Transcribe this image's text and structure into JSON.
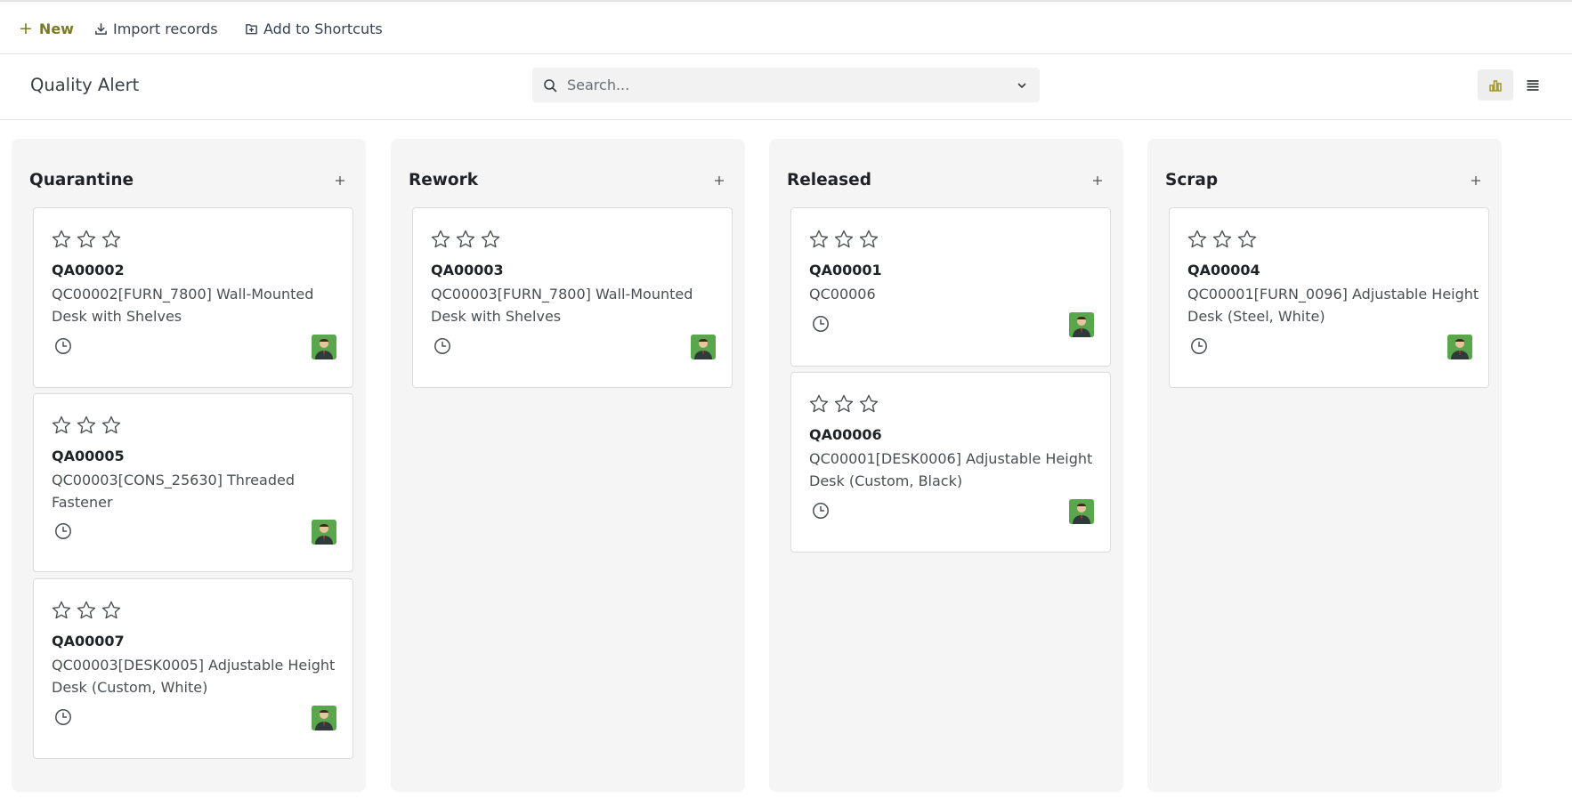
{
  "toolbar": {
    "new_label": "New",
    "import_label": "Import records",
    "shortcut_label": "Add to Shortcuts"
  },
  "page": {
    "title": "Quality Alert"
  },
  "search": {
    "placeholder": "Search..."
  },
  "colors": {
    "accent": "#7c7a1f",
    "column_bg": "#f5f5f5",
    "avatar_bg": "#5aa64d"
  },
  "icons": {
    "new": "plus-icon",
    "import": "download-icon",
    "shortcut": "shortcut-icon",
    "search": "search-icon",
    "dropdown": "chevron-down-icon",
    "kanban_view": "bar-chart-icon",
    "list_view": "list-icon",
    "rating": "star-icon",
    "activity": "clock-icon"
  },
  "columns": [
    {
      "title": "Quarantine",
      "cards": [
        {
          "ref": "QA00002",
          "desc": "QC00002[FURN_7800] Wall-Mounted Desk with Shelves",
          "stars": 0
        },
        {
          "ref": "QA00005",
          "desc": "QC00003[CONS_25630] Threaded Fastener",
          "stars": 0
        },
        {
          "ref": "QA00007",
          "desc": "QC00003[DESK0005] Adjustable Height Desk (Custom, White)",
          "stars": 0
        }
      ]
    },
    {
      "title": "Rework",
      "cards": [
        {
          "ref": "QA00003",
          "desc": "QC00003[FURN_7800] Wall-Mounted Desk with Shelves",
          "stars": 0
        }
      ]
    },
    {
      "title": "Released",
      "cards": [
        {
          "ref": "QA00001",
          "desc": "QC00006",
          "stars": 0
        },
        {
          "ref": "QA00006",
          "desc": "QC00001[DESK0006] Adjustable Height Desk (Custom, Black)",
          "stars": 0
        }
      ]
    },
    {
      "title": "Scrap",
      "cards": [
        {
          "ref": "QA00004",
          "desc": "QC00001[FURN_0096] Adjustable Height Desk (Steel, White)",
          "stars": 0
        }
      ]
    }
  ]
}
